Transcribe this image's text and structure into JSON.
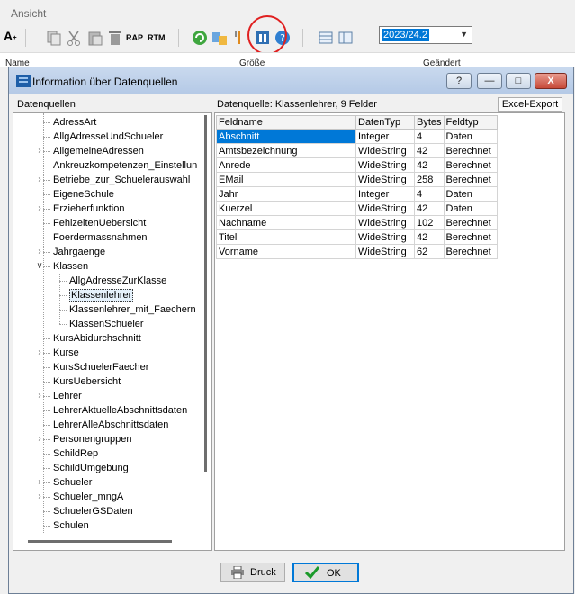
{
  "menu": {
    "ansicht": "Ansicht"
  },
  "toolbar": {
    "icons": [
      "font-size-icon",
      "copy-icon",
      "cut-icon",
      "paste-icon",
      "delete-icon",
      "rap-icon",
      "rtm-icon",
      "refresh-icon",
      "export-icon",
      "tools-icon",
      "datasource-info-icon",
      "help-icon",
      "grid-view-icon",
      "list-view-icon"
    ],
    "font_label": "A",
    "rap_label": "RAP",
    "rtm_label": "RTM",
    "year_value": "2023/24.2"
  },
  "background_headers": {
    "name": "Name",
    "size": "Größe",
    "changed": "Geändert"
  },
  "dialog": {
    "title": "Information über Datenquellen",
    "help_label": "?",
    "minimize_label": "—",
    "maximize_label": "□",
    "close_label": "X",
    "left_label": "Datenquellen",
    "right_label": "Datenquelle: Klassenlehrer, 9 Felder",
    "excel_button": "Excel-Export",
    "print_button": "Druck",
    "ok_button": "OK"
  },
  "tree": [
    {
      "label": "AdressArt",
      "level": 0,
      "expander": ""
    },
    {
      "label": "AllgAdresseUndSchueler",
      "level": 0,
      "expander": ""
    },
    {
      "label": "AllgemeineAdressen",
      "level": 0,
      "expander": ">"
    },
    {
      "label": "Ankreuzkompetenzen_Einstellun",
      "level": 0,
      "expander": ""
    },
    {
      "label": "Betriebe_zur_Schuelerauswahl",
      "level": 0,
      "expander": ">"
    },
    {
      "label": "EigeneSchule",
      "level": 0,
      "expander": ""
    },
    {
      "label": "Erzieherfunktion",
      "level": 0,
      "expander": ">"
    },
    {
      "label": "FehlzeitenUebersicht",
      "level": 0,
      "expander": ""
    },
    {
      "label": "Foerdermassnahmen",
      "level": 0,
      "expander": ""
    },
    {
      "label": "Jahrgaenge",
      "level": 0,
      "expander": ">"
    },
    {
      "label": "Klassen",
      "level": 0,
      "expander": "v"
    },
    {
      "label": "AllgAdresseZurKlasse",
      "level": 1,
      "expander": ""
    },
    {
      "label": "Klassenlehrer",
      "level": 1,
      "expander": "",
      "selected": true
    },
    {
      "label": "Klassenlehrer_mit_Faechern",
      "level": 1,
      "expander": ""
    },
    {
      "label": "KlassenSchueler",
      "level": 1,
      "expander": ""
    },
    {
      "label": "KursAbidurchschnitt",
      "level": 0,
      "expander": ""
    },
    {
      "label": "Kurse",
      "level": 0,
      "expander": ">"
    },
    {
      "label": "KursSchuelerFaecher",
      "level": 0,
      "expander": ""
    },
    {
      "label": "KursUebersicht",
      "level": 0,
      "expander": ""
    },
    {
      "label": "Lehrer",
      "level": 0,
      "expander": ">"
    },
    {
      "label": "LehrerAktuelleAbschnittsdaten",
      "level": 0,
      "expander": ""
    },
    {
      "label": "LehrerAlleAbschnittsdaten",
      "level": 0,
      "expander": ""
    },
    {
      "label": "Personengruppen",
      "level": 0,
      "expander": ">"
    },
    {
      "label": "SchildRep",
      "level": 0,
      "expander": ""
    },
    {
      "label": "SchildUmgebung",
      "level": 0,
      "expander": ""
    },
    {
      "label": "Schueler",
      "level": 0,
      "expander": ">"
    },
    {
      "label": "Schueler_mngA",
      "level": 0,
      "expander": ">"
    },
    {
      "label": "SchuelerGSDaten",
      "level": 0,
      "expander": ""
    },
    {
      "label": "Schulen",
      "level": 0,
      "expander": ""
    }
  ],
  "grid": {
    "columns": [
      "Feldname",
      "DatenTyp",
      "Bytes",
      "Feldtyp"
    ],
    "rows": [
      [
        "Abschnitt",
        "Integer",
        "4",
        "Daten"
      ],
      [
        "Amtsbezeichnung",
        "WideString",
        "42",
        "Berechnet"
      ],
      [
        "Anrede",
        "WideString",
        "42",
        "Berechnet"
      ],
      [
        "EMail",
        "WideString",
        "258",
        "Berechnet"
      ],
      [
        "Jahr",
        "Integer",
        "4",
        "Daten"
      ],
      [
        "Kuerzel",
        "WideString",
        "42",
        "Daten"
      ],
      [
        "Nachname",
        "WideString",
        "102",
        "Berechnet"
      ],
      [
        "Titel",
        "WideString",
        "42",
        "Berechnet"
      ],
      [
        "Vorname",
        "WideString",
        "62",
        "Berechnet"
      ]
    ],
    "selected_row": 0
  },
  "colors": {
    "selection": "#0078d7",
    "highlight_circle": "#e02020",
    "titlebar": "#c9d9ee"
  }
}
